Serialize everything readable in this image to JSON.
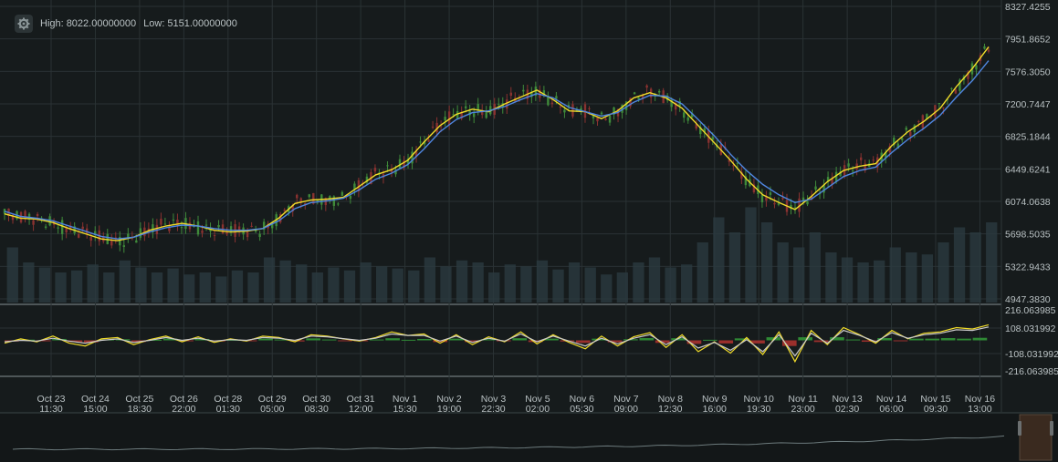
{
  "header": {
    "high_label": "High:",
    "high_value": "8022.00000000",
    "low_label": "Low:",
    "low_value": "5151.00000000",
    "settings_icon": "gear-icon"
  },
  "colors": {
    "background": "#161b1c",
    "grid": "#2a3234",
    "candle_up": "#3f8a3a",
    "candle_down": "#8a3230",
    "ma_fast": "#f1dc2a",
    "ma_slow": "#4f86e0",
    "volume": "#2a3a40",
    "macd_line": "#f1dc2a",
    "signal_line": "#c9c9c9",
    "hist_up": "#2f8a35",
    "hist_down": "#9a2f2c"
  },
  "chart_data": [
    {
      "type": "line",
      "panel": "price",
      "y_tick_labels": [
        "8327.4255",
        "7951.8652",
        "7576.3050",
        "7200.7447",
        "6825.1844",
        "6449.6241",
        "6074.0638",
        "5698.5035",
        "5322.9433",
        "4947.3830"
      ],
      "ylim": [
        4947.383,
        8327.4255
      ],
      "x_labels": [
        {
          "date": "Oct 23",
          "time": "11:30"
        },
        {
          "date": "Oct 24",
          "time": "15:00"
        },
        {
          "date": "Oct 25",
          "time": "18:30"
        },
        {
          "date": "Oct 26",
          "time": "22:00"
        },
        {
          "date": "Oct 28",
          "time": "01:30"
        },
        {
          "date": "Oct 29",
          "time": "05:00"
        },
        {
          "date": "Oct 30",
          "time": "08:30"
        },
        {
          "date": "Oct 31",
          "time": "12:00"
        },
        {
          "date": "Nov 1",
          "time": "15:30"
        },
        {
          "date": "Nov 2",
          "time": "19:00"
        },
        {
          "date": "Nov 3",
          "time": "22:30"
        },
        {
          "date": "Nov 5",
          "time": "02:00"
        },
        {
          "date": "Nov 6",
          "time": "05:30"
        },
        {
          "date": "Nov 7",
          "time": "09:00"
        },
        {
          "date": "Nov 8",
          "time": "12:30"
        },
        {
          "date": "Nov 9",
          "time": "16:00"
        },
        {
          "date": "Nov 10",
          "time": "19:30"
        },
        {
          "date": "Nov 11",
          "time": "23:00"
        },
        {
          "date": "Nov 13",
          "time": "02:30"
        },
        {
          "date": "Nov 14",
          "time": "06:00"
        },
        {
          "date": "Nov 15",
          "time": "09:30"
        },
        {
          "date": "Nov 16",
          "time": "13:00"
        }
      ],
      "high": 8022,
      "low": 5151,
      "series": [
        {
          "role": "fast-ma",
          "values": [
            5930,
            5880,
            5870,
            5830,
            5760,
            5700,
            5640,
            5620,
            5660,
            5740,
            5790,
            5820,
            5790,
            5740,
            5720,
            5730,
            5760,
            5880,
            6050,
            6090,
            6100,
            6120,
            6250,
            6380,
            6440,
            6550,
            6760,
            6950,
            7080,
            7140,
            7110,
            7200,
            7280,
            7360,
            7250,
            7120,
            7110,
            7030,
            7120,
            7270,
            7330,
            7270,
            7150,
            6950,
            6750,
            6550,
            6330,
            6150,
            6060,
            5980,
            6130,
            6300,
            6430,
            6480,
            6510,
            6720,
            6880,
            7000,
            7150,
            7400,
            7610,
            7860
          ]
        },
        {
          "role": "slow-ma",
          "values": [
            5960,
            5900,
            5880,
            5850,
            5790,
            5730,
            5670,
            5640,
            5660,
            5720,
            5770,
            5800,
            5790,
            5760,
            5740,
            5740,
            5760,
            5850,
            5990,
            6060,
            6080,
            6110,
            6210,
            6330,
            6400,
            6500,
            6680,
            6880,
            7020,
            7100,
            7120,
            7170,
            7250,
            7320,
            7270,
            7160,
            7110,
            7060,
            7100,
            7220,
            7300,
            7290,
            7200,
            7020,
            6830,
            6620,
            6430,
            6270,
            6150,
            6060,
            6100,
            6230,
            6360,
            6430,
            6470,
            6640,
            6790,
            6920,
            7070,
            7280,
            7470,
            7700
          ]
        }
      ],
      "volume": [
        0.55,
        0.4,
        0.35,
        0.3,
        0.32,
        0.38,
        0.3,
        0.42,
        0.35,
        0.3,
        0.34,
        0.28,
        0.3,
        0.26,
        0.32,
        0.3,
        0.45,
        0.42,
        0.38,
        0.3,
        0.35,
        0.32,
        0.4,
        0.36,
        0.34,
        0.32,
        0.45,
        0.36,
        0.42,
        0.4,
        0.3,
        0.38,
        0.36,
        0.42,
        0.33,
        0.4,
        0.35,
        0.28,
        0.3,
        0.4,
        0.45,
        0.35,
        0.38,
        0.6,
        0.85,
        0.7,
        0.95,
        0.8,
        0.6,
        0.55,
        0.7,
        0.5,
        0.45,
        0.4,
        0.42,
        0.55,
        0.5,
        0.48,
        0.6,
        0.75,
        0.7,
        0.8
      ]
    },
    {
      "type": "line",
      "panel": "macd",
      "y_tick_labels": [
        "216.063985",
        "108.031992",
        "-108.031992",
        "-216.063985"
      ],
      "ylim": [
        -216.063985,
        216.063985
      ],
      "series": [
        {
          "role": "macd",
          "values": [
            -20,
            10,
            -10,
            30,
            -20,
            -40,
            10,
            20,
            -30,
            5,
            30,
            -10,
            25,
            -15,
            10,
            -5,
            30,
            20,
            -10,
            40,
            30,
            10,
            -5,
            20,
            60,
            35,
            45,
            -20,
            40,
            -30,
            25,
            -10,
            60,
            -25,
            40,
            -15,
            -60,
            30,
            -40,
            25,
            55,
            -50,
            40,
            -80,
            -10,
            -90,
            20,
            -100,
            60,
            -150,
            70,
            -30,
            90,
            40,
            -20,
            70,
            10,
            50,
            60,
            90,
            80,
            110
          ]
        },
        {
          "role": "signal",
          "values": [
            -10,
            0,
            -5,
            15,
            -5,
            -20,
            0,
            10,
            -15,
            0,
            20,
            0,
            15,
            -5,
            5,
            0,
            20,
            15,
            0,
            30,
            25,
            12,
            0,
            15,
            45,
            35,
            35,
            -5,
            30,
            -15,
            15,
            -5,
            45,
            -10,
            30,
            -5,
            -40,
            15,
            -25,
            15,
            40,
            -30,
            25,
            -55,
            -15,
            -70,
            5,
            -80,
            40,
            -110,
            50,
            -20,
            70,
            35,
            -10,
            55,
            15,
            40,
            50,
            75,
            70,
            95
          ]
        }
      ],
      "histogram": [
        -8,
        5,
        -4,
        10,
        -12,
        -15,
        6,
        8,
        -12,
        4,
        12,
        -6,
        10,
        -8,
        4,
        -3,
        12,
        6,
        -8,
        14,
        6,
        -2,
        -4,
        6,
        15,
        4,
        10,
        -12,
        12,
        -12,
        8,
        -4,
        15,
        -12,
        12,
        -8,
        -18,
        12,
        -14,
        8,
        16,
        -18,
        15,
        -25,
        4,
        -22,
        14,
        -22,
        22,
        -40,
        22,
        -12,
        22,
        6,
        -10,
        16,
        -4,
        12,
        12,
        16,
        12,
        18
      ]
    }
  ]
}
